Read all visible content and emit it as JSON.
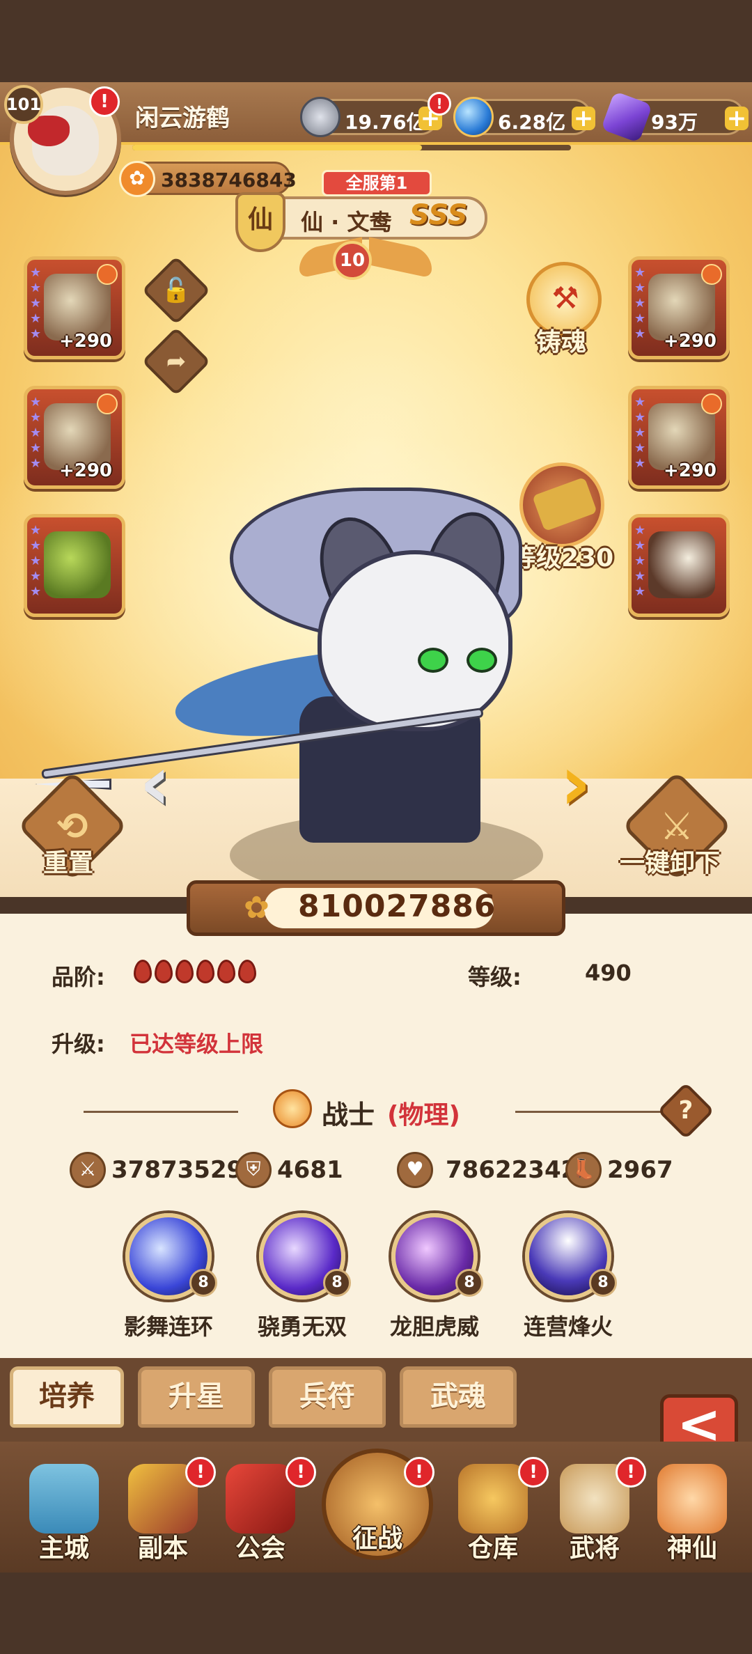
{
  "player": {
    "name": "闲云游鹤",
    "level": "101",
    "power": "3838746843",
    "avatar_alert": "!"
  },
  "currencies": [
    {
      "name": "coin",
      "value": "19.76亿",
      "icon": "coin-icon",
      "color": "#8b8f9c"
    },
    {
      "name": "orb",
      "value": "6.28亿",
      "icon": "blue-orb-icon",
      "color": "#2a7bd6",
      "alert": "!"
    },
    {
      "name": "crystal",
      "value": "93万",
      "icon": "purple-crystal-icon",
      "color": "#7b44d4"
    }
  ],
  "exp_fraction": 0.66,
  "title": {
    "rank": "全服第1",
    "shield_char": "仙",
    "name": "仙 · 文鸯",
    "grade": "SSS",
    "level": "10"
  },
  "equipment": {
    "left": [
      {
        "plus": "+290",
        "icon": "armor-icon"
      },
      {
        "plus": "+290",
        "icon": "armor-icon"
      },
      {
        "plus": "",
        "icon": "jade-treasure-icon"
      }
    ],
    "right": [
      {
        "plus": "+290",
        "icon": "armor-icon"
      },
      {
        "plus": "+290",
        "icon": "armor-icon"
      },
      {
        "plus": "",
        "icon": "fan-icon"
      }
    ]
  },
  "actions": {
    "soul_forge": "铸魂",
    "mount_level": "等级230",
    "mount_star": "10",
    "reset": "重置",
    "unequip_all": "一键卸下"
  },
  "combat_power": "810027886",
  "info": {
    "grade_label": "品阶:",
    "grade_flames": 6,
    "level_label": "等级:",
    "level_value": "490",
    "upgrade_label": "升级:",
    "upgrade_value": "已达等级上限",
    "class_name": "战士",
    "class_type": "(物理)",
    "help": "?"
  },
  "stats": [
    {
      "icon": "sword-icon",
      "value": "37873529"
    },
    {
      "icon": "shield-icon",
      "value": "4681"
    },
    {
      "icon": "heart-icon",
      "value": "78622342"
    },
    {
      "icon": "boot-icon",
      "value": "2967"
    }
  ],
  "skills": [
    {
      "name": "影舞连环",
      "level": "8",
      "color": "#3a46d8"
    },
    {
      "name": "骁勇无双",
      "level": "8",
      "color": "#5a2ac8"
    },
    {
      "name": "龙胆虎威",
      "level": "8",
      "color": "#6a2aa8"
    },
    {
      "name": "连营烽火",
      "level": "8",
      "color": "#4a3ab8"
    }
  ],
  "tabs": [
    {
      "label": "培养",
      "active": true
    },
    {
      "label": "升星",
      "active": false
    },
    {
      "label": "兵符",
      "active": false
    },
    {
      "label": "武魂",
      "active": false
    }
  ],
  "back": "<",
  "nav": [
    {
      "label": "主城",
      "icon": "city-icon",
      "alert": ""
    },
    {
      "label": "副本",
      "icon": "dungeon-icon",
      "alert": "!"
    },
    {
      "label": "公会",
      "icon": "guild-flag-icon",
      "alert": "!"
    },
    {
      "label": "征战",
      "icon": "battle-icon",
      "alert": "!"
    },
    {
      "label": "仓库",
      "icon": "warehouse-bag-icon",
      "alert": "!"
    },
    {
      "label": "武将",
      "icon": "general-icon",
      "alert": "!"
    },
    {
      "label": "神仙",
      "icon": "immortal-cat-icon",
      "alert": ""
    }
  ]
}
